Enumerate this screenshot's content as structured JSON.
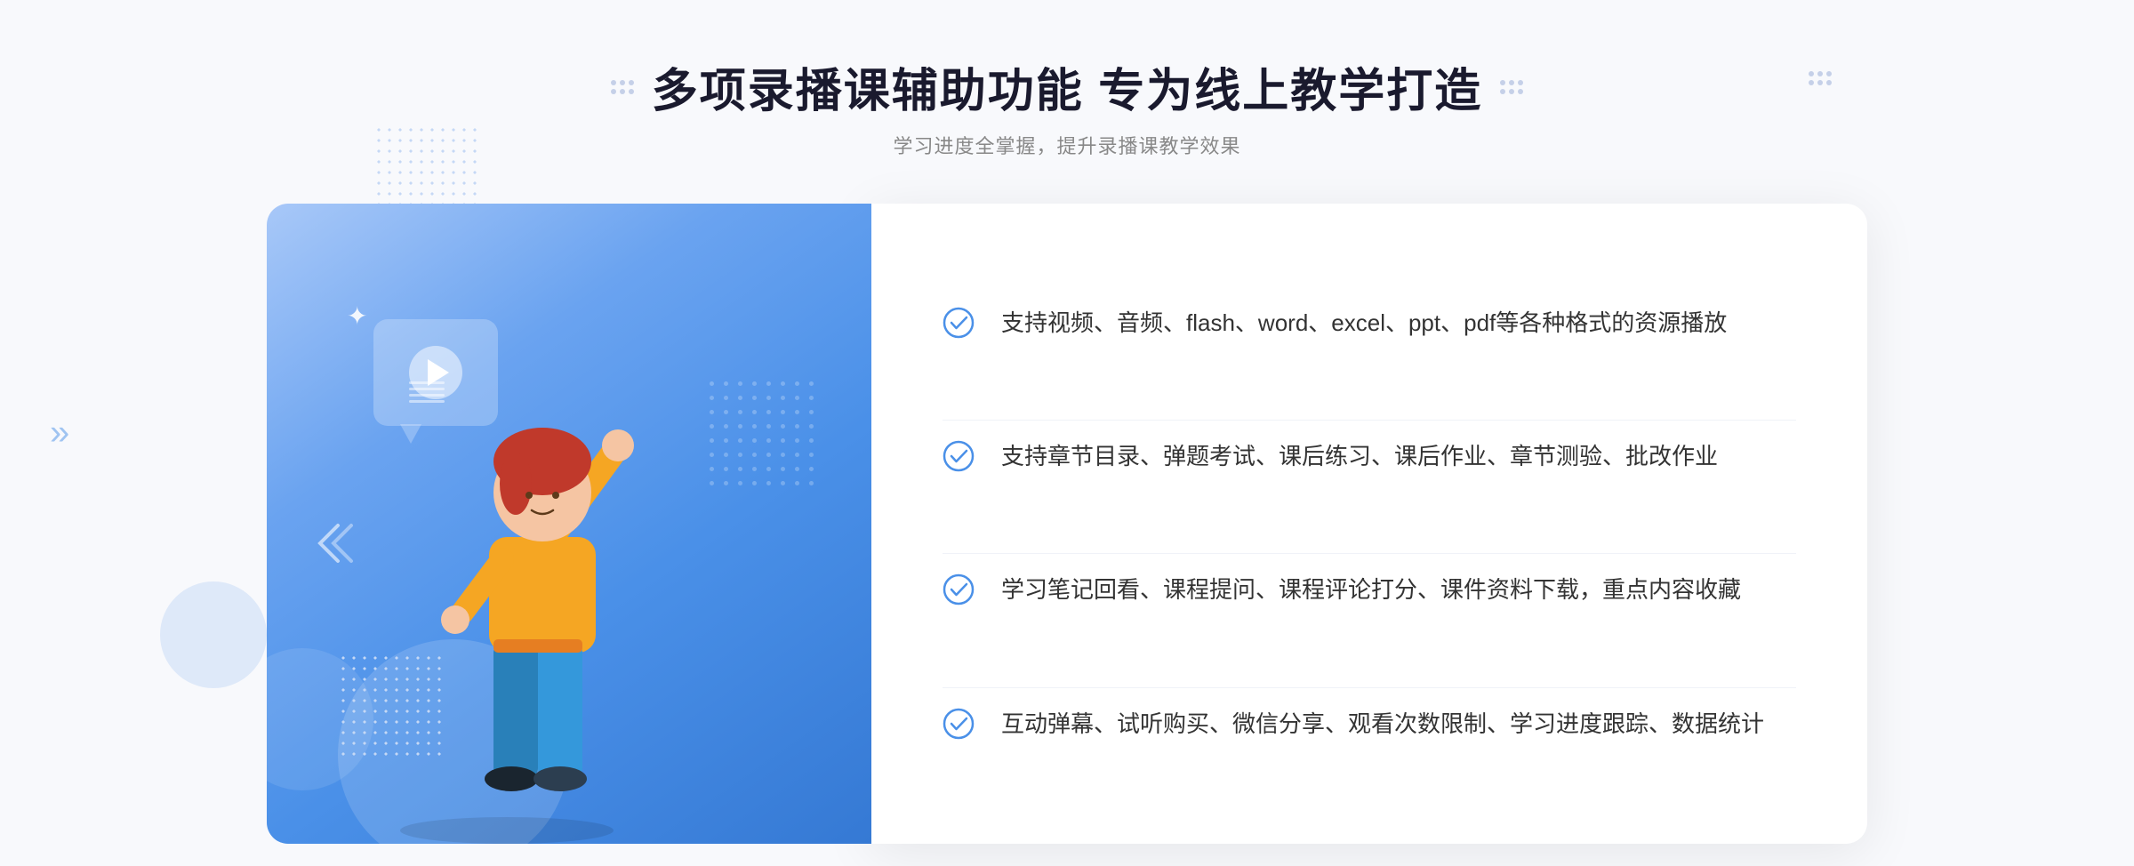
{
  "header": {
    "main_title": "多项录播课辅助功能 专为线上教学打造",
    "sub_title": "学习进度全掌握，提升录播课教学效果"
  },
  "features": [
    {
      "id": 1,
      "text": "支持视频、音频、flash、word、excel、ppt、pdf等各种格式的资源播放"
    },
    {
      "id": 2,
      "text": "支持章节目录、弹题考试、课后练习、课后作业、章节测验、批改作业"
    },
    {
      "id": 3,
      "text": "学习笔记回看、课程提问、课程评论打分、课件资料下载，重点内容收藏"
    },
    {
      "id": 4,
      "text": "互动弹幕、试听购买、微信分享、观看次数限制、学习进度跟踪、数据统计"
    }
  ],
  "colors": {
    "accent_blue": "#4a90e8",
    "light_blue": "#6aaff5",
    "check_green": "#5b9cf6",
    "text_dark": "#1a1a2e",
    "text_gray": "#888888",
    "text_feature": "#333333"
  },
  "icons": {
    "play": "▶",
    "check": "✓",
    "chevron": "»",
    "sparkle": "✦"
  }
}
